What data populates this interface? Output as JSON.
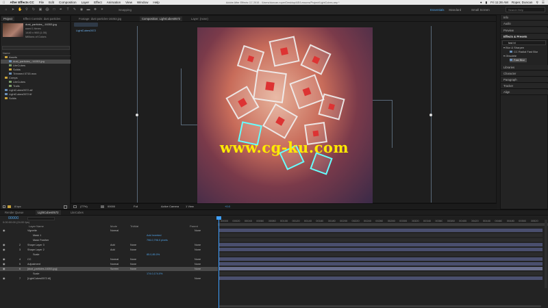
{
  "menubar": {
    "app_name": "After Effects CC",
    "menus": [
      "File",
      "Edit",
      "Composition",
      "Layer",
      "Effect",
      "Animation",
      "View",
      "Window",
      "Help"
    ],
    "title": "Adobe After Effects CC 2015 - /Users/duncan.roper/Desktop/AE/Lessons/Project/LightCubes.aep *",
    "time": "Fri 11:26 AM",
    "user": "Roper, Duncan"
  },
  "toolbar": {
    "snapping_label": "Snapping",
    "workspaces": [
      "Essentials",
      "Standard",
      "Small Screen"
    ],
    "search_placeholder": "Search Help"
  },
  "project_panel": {
    "tabs": [
      "Project",
      "Effect Controls: dust particles"
    ],
    "thumb_name": "dust_particles_-16353.jpg",
    "thumb_info_1": "used 1 times",
    "thumb_info_2": "1440 x 960 (1.00)",
    "thumb_info_3": "Millions of Colors",
    "name_header": "Name",
    "items": [
      {
        "name": "Assets",
        "type": "folder",
        "indent": 0
      },
      {
        "name": "dust_particles_-16353.jpg",
        "type": "image",
        "indent": 1,
        "selected": true
      },
      {
        "name": "LiteCubes",
        "type": "comp",
        "indent": 1
      },
      {
        "name": "Solids",
        "type": "folder",
        "indent": 1
      },
      {
        "name": "Trimmed 0715.mov",
        "type": "image",
        "indent": 1
      },
      {
        "name": "Comps",
        "type": "folder",
        "indent": 0
      },
      {
        "name": "LiteCubes",
        "type": "comp",
        "indent": 1
      },
      {
        "name": "Trails",
        "type": "comp",
        "indent": 1
      },
      {
        "name": "LightCubes0572.aif",
        "type": "image",
        "indent": 0
      },
      {
        "name": "LightCubes0572.tif",
        "type": "image",
        "indent": 0
      },
      {
        "name": "Solids",
        "type": "folder",
        "indent": 0
      }
    ],
    "bpc": "8 bpc"
  },
  "viewer": {
    "tabs": [
      "Footage: dust particles-16353.jpg",
      "Composition: LightCubes0572",
      "Layer: (none)"
    ],
    "breadcrumb": "LightCubes0572",
    "watermark": "www.cg-ku.com",
    "zoom": "(77%)",
    "timecode": "00000",
    "resolution": "Full",
    "camera": "Active Camera",
    "views": "1 View",
    "exposure": "+0.0"
  },
  "right_panel": {
    "info": "Info",
    "audio": "Audio",
    "preview": "Preview",
    "effects_presets": "Effects & Presets",
    "effects_search": "fast bl",
    "blur_category": "Blur & Sharpen",
    "effect_1": "CC Radial Fast Blur",
    "obsolete_category": "Obsolete",
    "effect_2": "Fast Blur",
    "libraries": "Libraries",
    "character": "Character",
    "paragraph": "Paragraph",
    "tracker": "Tracker",
    "align": "Align"
  },
  "timeline": {
    "tabs": [
      "Render Queue",
      "LightCubes0572",
      "LiteCubes"
    ],
    "timecode": "00000",
    "fps": "0:00:00:00 (24.00 fps)",
    "columns": {
      "layer_name": "Layer Name",
      "mode": "Mode",
      "trkmat": "TrkMat",
      "parent": "Parent"
    },
    "rows": [
      {
        "num": "",
        "name": "Vignette",
        "mode": "Normal",
        "trkmat": "",
        "parent": "None",
        "kind": "layer"
      },
      {
        "num": "",
        "name": "Mask 1",
        "mode": "",
        "trkmat": "",
        "parent": "",
        "kind": "sub",
        "value": "Add   Inverted"
      },
      {
        "num": "",
        "name": "Mask Feather",
        "mode": "",
        "trkmat": "",
        "parent": "",
        "kind": "sub",
        "value": "796.0,796.0 pixels"
      },
      {
        "num": "2",
        "name": "Shape Layer 3",
        "mode": "Add",
        "trkmat": "None",
        "parent": "None",
        "kind": "layer"
      },
      {
        "num": "3",
        "name": "Shape Layer 2",
        "mode": "Add",
        "trkmat": "None",
        "parent": "None",
        "kind": "layer"
      },
      {
        "num": "",
        "name": "Scale",
        "mode": "",
        "trkmat": "",
        "parent": "",
        "kind": "sub",
        "value": "85.0,85.0%"
      },
      {
        "num": "4",
        "name": "CC",
        "mode": "Normal",
        "trkmat": "None",
        "parent": "None",
        "kind": "layer"
      },
      {
        "num": "5",
        "name": "Adjustment",
        "mode": "Normal",
        "trkmat": "None",
        "parent": "None",
        "kind": "layer"
      },
      {
        "num": "6",
        "name": "[dust_particles-16353.jpg]",
        "mode": "Screen",
        "trkmat": "None",
        "parent": "None",
        "kind": "layer",
        "selected": true
      },
      {
        "num": "",
        "name": "Scale",
        "mode": "",
        "trkmat": "",
        "parent": "",
        "kind": "sub",
        "value": "174.0,174.0%"
      },
      {
        "num": "7",
        "name": "[LightCubes0572.tif]",
        "mode": "",
        "trkmat": "",
        "parent": "None",
        "kind": "layer"
      }
    ],
    "ruler": [
      "00000",
      "00020",
      "00040",
      "00060",
      "00080",
      "00100",
      "00120",
      "00140",
      "00160",
      "00180",
      "00200",
      "00220",
      "00240",
      "00260",
      "00280",
      "00300",
      "00320",
      "00340",
      "00360",
      "00380",
      "00400",
      "00420",
      "00440",
      "00460",
      "00480",
      "00500",
      "00520"
    ]
  }
}
